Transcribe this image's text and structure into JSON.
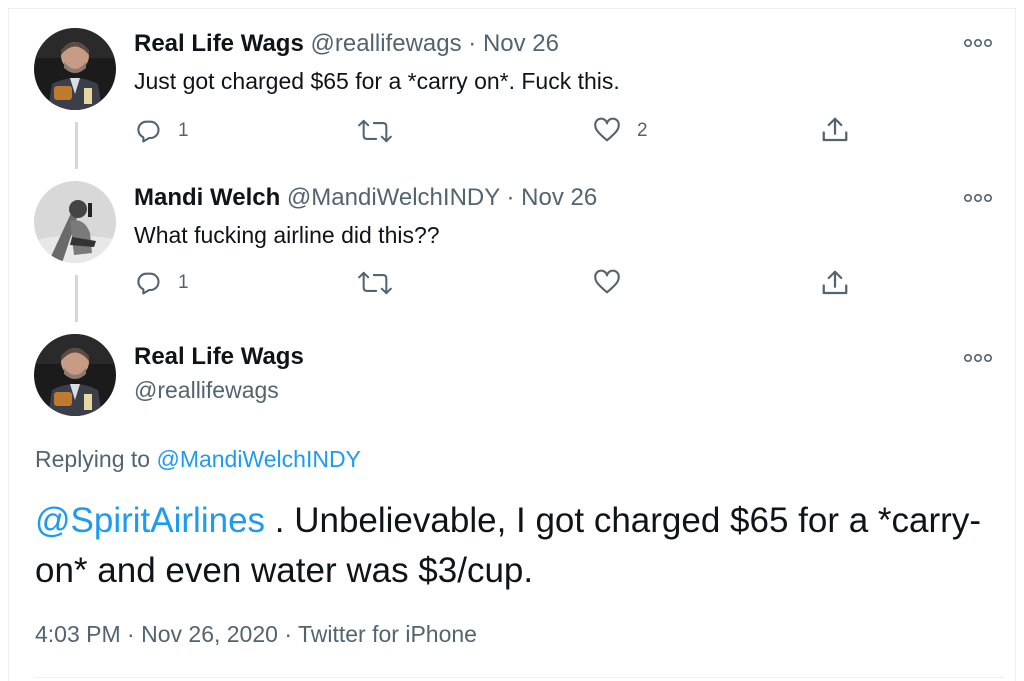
{
  "tweets": [
    {
      "name": "Real Life Wags",
      "handle": "@reallifewags",
      "sep": "·",
      "date": "Nov 26",
      "text": "Just got charged $65 for a *carry on*. Fuck this.",
      "reply_count": "1",
      "retweet_count": "",
      "like_count": "2"
    },
    {
      "name": "Mandi Welch",
      "handle": "@MandiWelchINDY",
      "sep": "·",
      "date": "Nov 26",
      "text": "What fucking airline did this??",
      "reply_count": "1",
      "retweet_count": "",
      "like_count": ""
    }
  ],
  "focused": {
    "name": "Real Life Wags",
    "handle": "@reallifewags",
    "replying_prefix": "Replying to",
    "replying_handle": "@MandiWelchINDY",
    "mention": "@SpiritAirlines",
    "text": " . Unbelievable, I got charged $65 for a *carry-on* and even water was $3/cup.",
    "time": "4:03 PM",
    "date": "Nov 26, 2020",
    "client": "Twitter for iPhone",
    "sep": "·"
  },
  "icons": {
    "reply": "reply-icon",
    "retweet": "retweet-icon",
    "like": "heart-icon",
    "share": "share-icon",
    "more": "more-options-icon"
  },
  "colors": {
    "text": "#0f1419",
    "secondary": "#536471",
    "link": "#1d9bf0",
    "divider": "#eceff1",
    "thread_line": "#cfd9de"
  }
}
